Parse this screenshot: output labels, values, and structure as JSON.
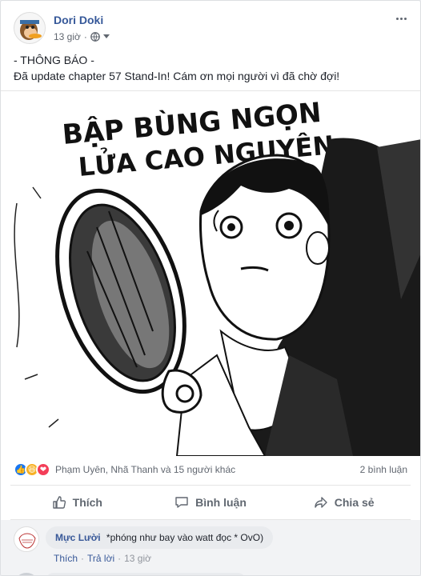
{
  "post": {
    "author": "Dori Doki",
    "time": "13 giờ",
    "privacy_icon": "globe-icon",
    "text_line1": "- THÔNG BÁO -",
    "text_line2": "Đã update chapter 57 Stand-In! Cám ơn mọi người vì đã chờ đợi!",
    "image_caption_line1": "BẬP BÙNG NGỌN",
    "image_caption_line2": "LỬA CAO NGUYÊN"
  },
  "reactions": {
    "names": "Phạm Uyên, Nhã Thanh và 15 người khác",
    "comments": "2 bình luận",
    "like_color": "#1877f2",
    "haha_color": "#f7b125",
    "love_color": "#f33e58"
  },
  "actions": {
    "like": "Thích",
    "comment": "Bình luận",
    "share": "Chia sẻ"
  },
  "comment": {
    "name": "Mực Lười",
    "text": "*phóng như bay vào watt đọc * OvO)",
    "like": "Thích",
    "reply": "Trả lời",
    "time": "13 giờ"
  }
}
